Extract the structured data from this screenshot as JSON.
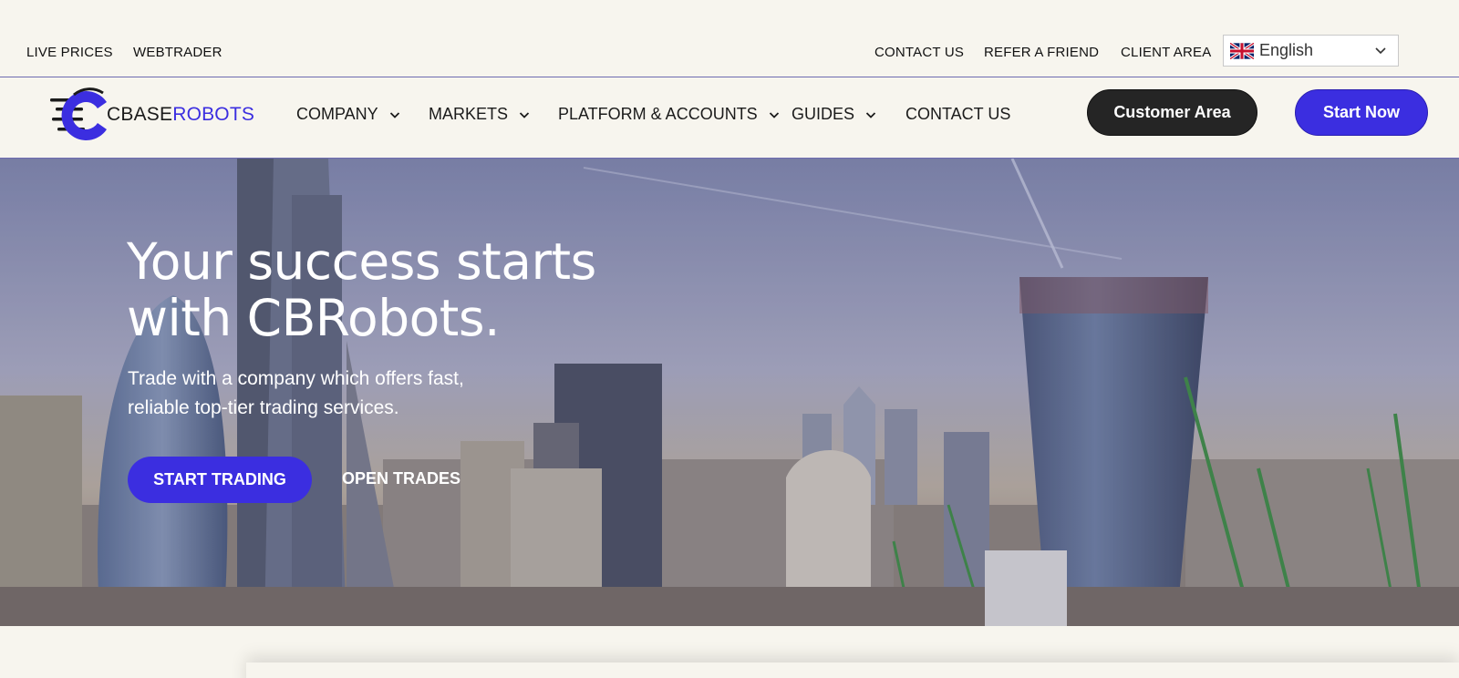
{
  "topbar": {
    "left_links": [
      "LIVE PRICES",
      "WEBTRADER"
    ],
    "right_links": [
      "CONTACT US",
      "REFER A FRIEND",
      "CLIENT AREA"
    ],
    "language": {
      "selected": "English",
      "flag_icon": "uk-flag-icon"
    }
  },
  "logo": {
    "part1": "CBASE",
    "part2": "ROBOTS"
  },
  "nav": {
    "items": [
      {
        "label": "COMPANY",
        "has_dropdown": true
      },
      {
        "label": "MARKETS",
        "has_dropdown": true
      },
      {
        "label": "PLATFORM & ACCOUNTS",
        "has_dropdown": true
      },
      {
        "label": "GUIDES",
        "has_dropdown": true
      },
      {
        "label": "CONTACT US",
        "has_dropdown": false
      }
    ],
    "customer_area": "Customer Area",
    "start_now": "Start Now"
  },
  "hero": {
    "title": "Your success starts\nwith CBRobots.",
    "subtitle": "Trade with a company which offers fast,\nreliable top-tier trading services.",
    "primary_cta": "START TRADING",
    "secondary_cta": "OPEN TRADES"
  },
  "colors": {
    "accent": "#3b2ee0",
    "dark_button": "#252525",
    "page_bg": "#f7f5ee"
  }
}
